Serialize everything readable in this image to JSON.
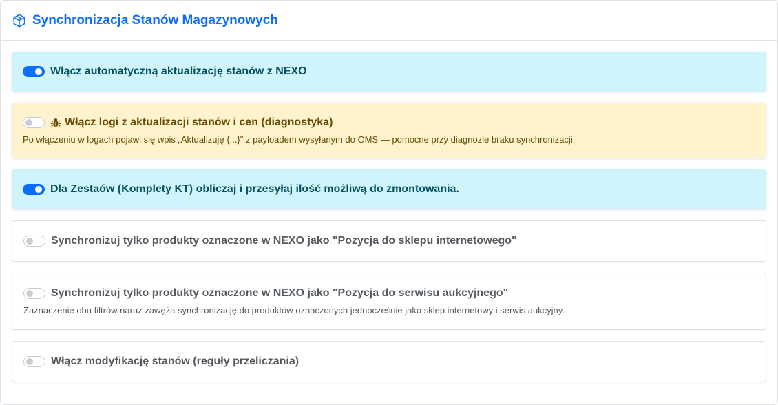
{
  "header": {
    "title": "Synchronizacja Stanów Magazynowych",
    "icon": "box-icon",
    "accent_color": "#0d6efd"
  },
  "options": [
    {
      "label": "Włącz automatyczną aktualizację stanów z NEXO",
      "enabled": true,
      "variant": "info",
      "help": ""
    },
    {
      "label": "Włącz logi z aktualizacji stanów i cen (diagnostyka)",
      "enabled": false,
      "variant": "warning",
      "icon": "bug-icon",
      "help": "Po włączeniu w logach pojawi się wpis „Aktualizuję {...}\" z payloadem wysyłanym do OMS — pomocne przy diagnozie braku synchronizacji."
    },
    {
      "label": "Dla Zestaów (Komplety KT) obliczaj i przesyłaj ilość możliwą do zmontowania.",
      "enabled": true,
      "variant": "info",
      "help": ""
    },
    {
      "label": "Synchronizuj tylko produkty oznaczone w NEXO jako \"Pozycja do sklepu internetowego\"",
      "enabled": false,
      "variant": "plain",
      "help": ""
    },
    {
      "label": "Synchronizuj tylko produkty oznaczone w NEXO jako \"Pozycja do serwisu aukcyjnego\"",
      "enabled": false,
      "variant": "plain",
      "help": "Zaznaczenie obu filtrów naraz zawęża synchronizację do produktów oznaczonych jednocześnie jako sklep internetowy i serwis aukcyjny."
    },
    {
      "label": "Włącz modyfikację stanów (reguły przeliczania)",
      "enabled": false,
      "variant": "plain",
      "help": ""
    }
  ]
}
